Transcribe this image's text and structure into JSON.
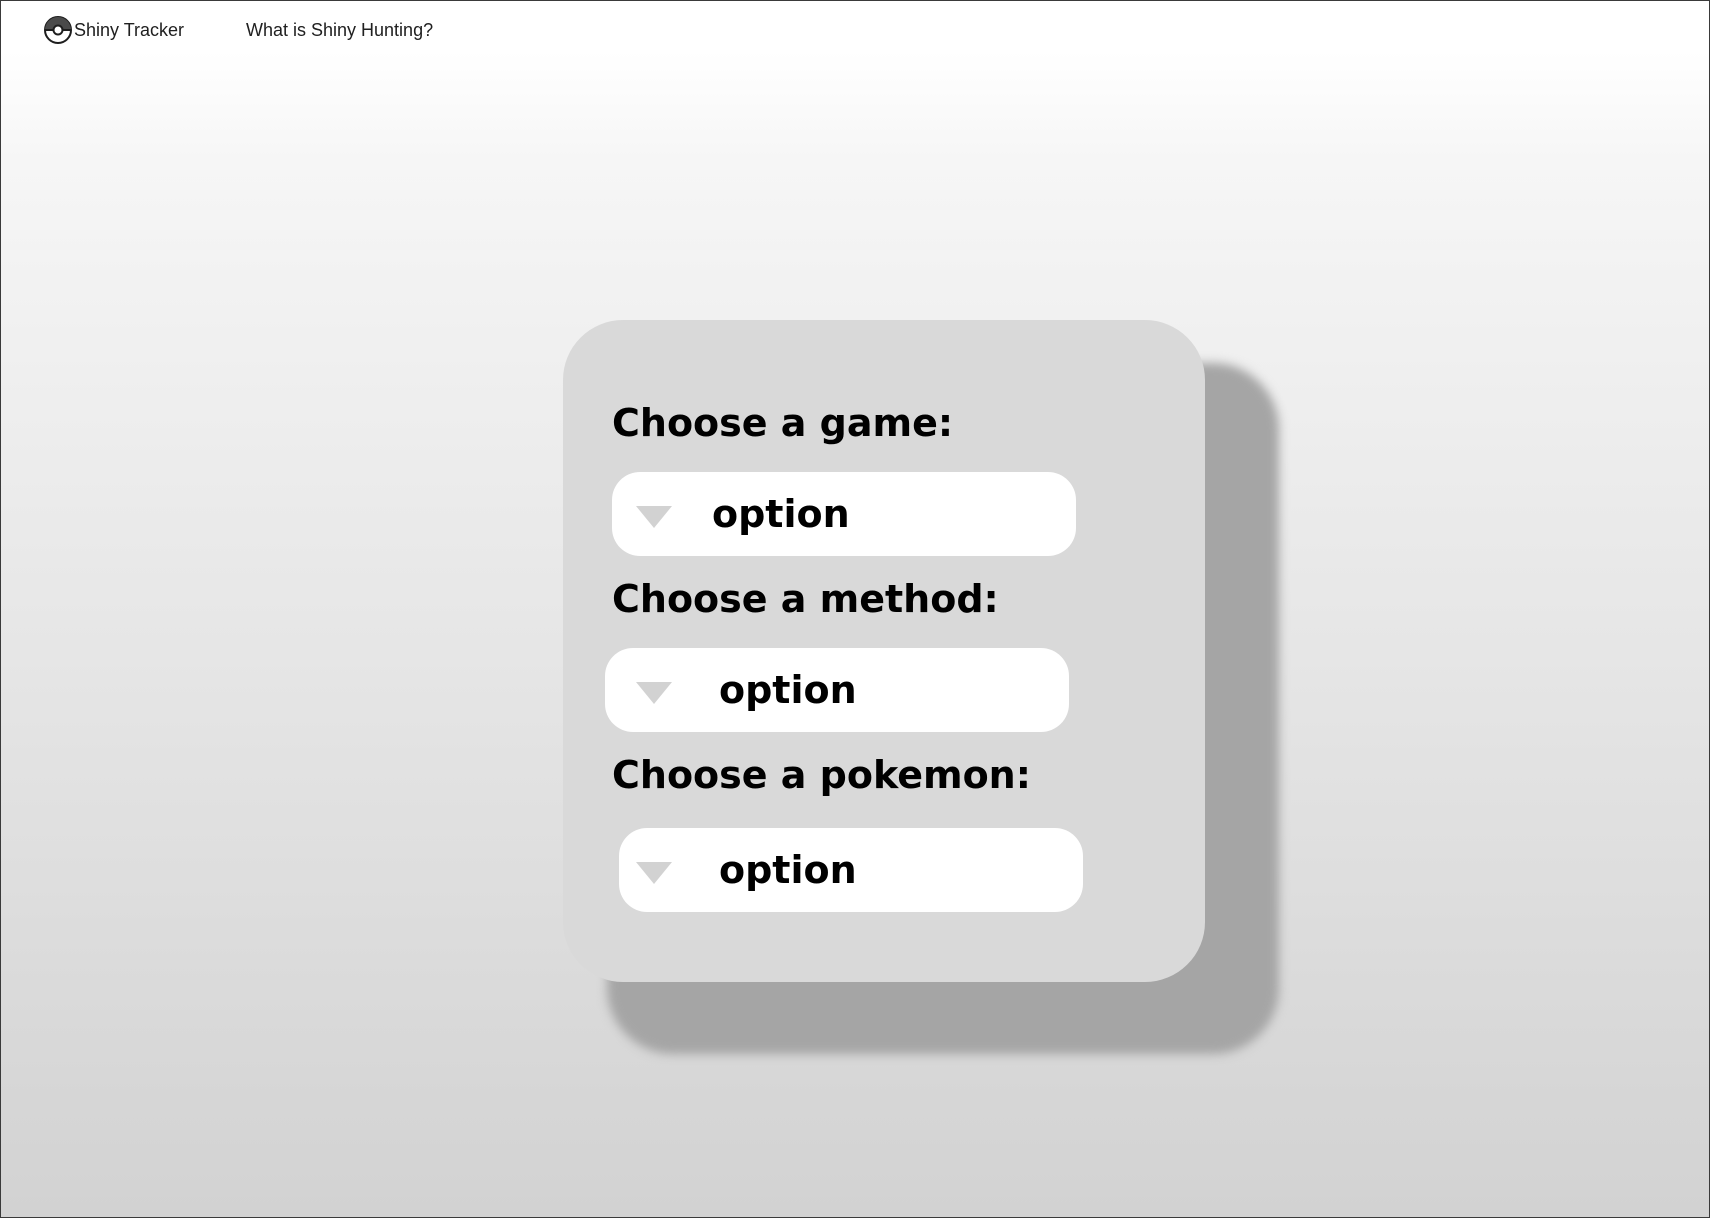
{
  "nav": {
    "brand": "Shiny Tracker",
    "brand_icon": "pokeball-icon",
    "link": "What is Shiny Hunting?"
  },
  "form": {
    "game": {
      "label": "Choose a game:",
      "value": "option"
    },
    "method": {
      "label": "Choose a method:",
      "value": "option"
    },
    "pokemon": {
      "label": "Choose a pokemon:",
      "value": "option"
    }
  },
  "colors": {
    "card": "#d9d9d9",
    "card_shadow": "#a5a5a5",
    "select": "#ffffff",
    "arrow": "#d2d2d2"
  }
}
